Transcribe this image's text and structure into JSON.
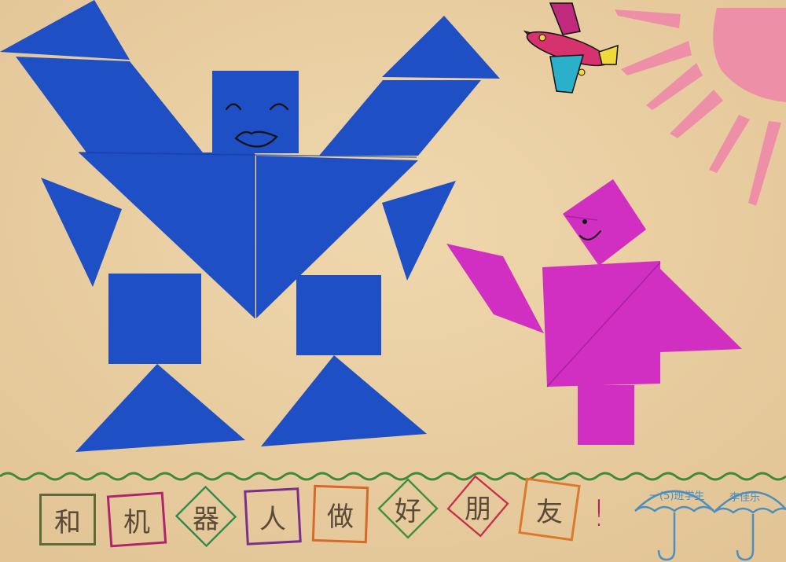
{
  "caption": {
    "characters": [
      "和",
      "机",
      "器",
      "人",
      "做",
      "好",
      "朋",
      "友"
    ],
    "exclamation": "!",
    "box_colors": [
      "#5d6b3a",
      "#b0246a",
      "#2c8a4b",
      "#7b2f8c",
      "#d66a2a",
      "#3a8f3a",
      "#c4314a",
      "#d97a2e"
    ]
  },
  "signature": {
    "class_text": "一(5)班学生",
    "name_text": "李佳乐"
  },
  "colors": {
    "paper": "#e9cfa3",
    "robot_blue": "#1f4fc4",
    "girl_magenta": "#d12fc2",
    "sun_pink": "#ee8fa8",
    "wave_green": "#3d8a3a",
    "umbrella_blue": "#4b8fbf",
    "face_line": "#111111"
  },
  "icons": [
    "robot-figure",
    "girl-figure",
    "sun-icon",
    "airplane-sticker",
    "umbrella-icon"
  ]
}
